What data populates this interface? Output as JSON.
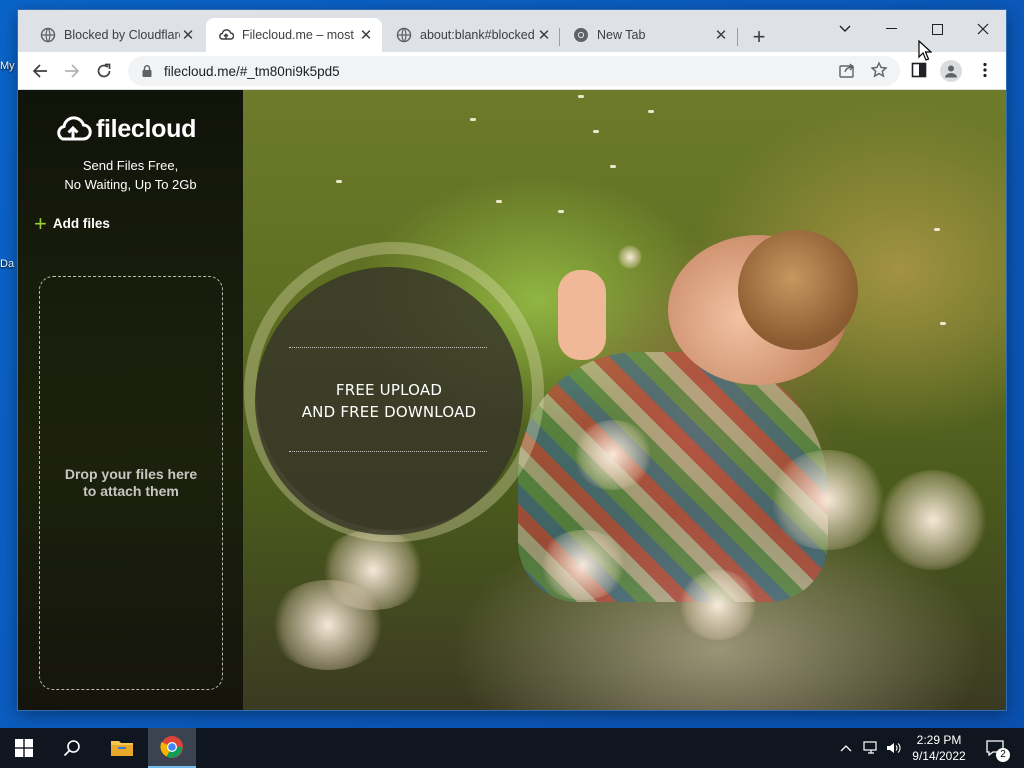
{
  "desktop": {
    "icon_fragments": [
      "My",
      "Da"
    ]
  },
  "browser": {
    "tabs": [
      {
        "title": "Blocked by Cloudflare",
        "favicon": "globe-icon",
        "active": false
      },
      {
        "title": "Filecloud.me – most s",
        "favicon": "cloud-upload-icon",
        "active": true
      },
      {
        "title": "about:blank#blocked",
        "favicon": "globe-icon",
        "active": false
      },
      {
        "title": "New Tab",
        "favicon": "chrome-icon",
        "active": false
      }
    ],
    "new_tab_symbol": "+",
    "address": {
      "url": "filecloud.me/#_tm80ni9k5pd5",
      "icon": "lock-icon"
    },
    "window_controls": [
      "tab-search",
      "minimize",
      "maximize",
      "close"
    ]
  },
  "page": {
    "brand": "filecloud",
    "tagline_line1": "Send Files Free,",
    "tagline_line2": "No Waiting, Up To 2Gb",
    "add_files_label": "Add files",
    "dropzone_line1": "Drop your files here",
    "dropzone_line2": "to attach them",
    "circle_line1": "FREE UPLOAD",
    "circle_line2": "AND FREE DOWNLOAD"
  },
  "taskbar": {
    "time": "2:29 PM",
    "date": "9/14/2022",
    "notification_count": "2",
    "pinned": [
      "start-button",
      "search-button",
      "file-explorer",
      "chrome"
    ]
  },
  "colors": {
    "accent_green": "#9acd32",
    "taskbar": "#10161f",
    "tabstrip": "#dee1e6"
  }
}
